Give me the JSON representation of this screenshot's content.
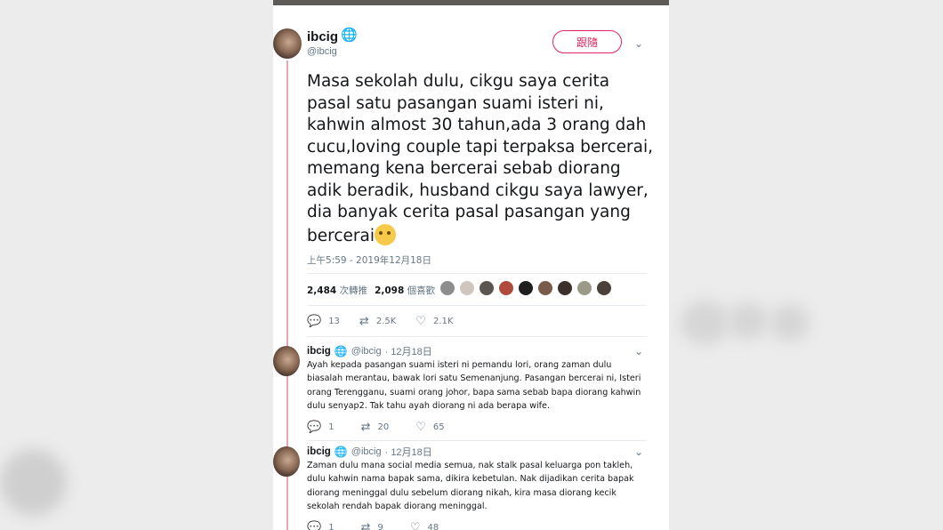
{
  "tweet": {
    "author_name": "ibcig",
    "author_handle": "@ibcig",
    "follow_label": "跟隨",
    "text": "Masa sekolah dulu, cikgu saya cerita pasal satu pasangan suami isteri ni, kahwin almost 30 tahun,ada 3 orang dah cucu,loving couple tapi terpaksa bercerai, memang kena bercerai sebab diorang adik beradik, husband cikgu saya lawyer, dia banyak cerita pasal pasangan yang bercerai",
    "timestamp": "上午5:59 - 2019年12月18日",
    "retweets_count": "2,484",
    "retweets_label": "次轉推",
    "likes_count": "2,098",
    "likes_label": "個喜歡",
    "liker_colors": [
      "#8d8d8d",
      "#cfc6c0",
      "#5b5552",
      "#b04a3c",
      "#1f1f1f",
      "#7a5a4a",
      "#3a2f2b",
      "#9a9a86",
      "#4b403a"
    ],
    "replies": "13",
    "retweets_short": "2.5K",
    "likes_short": "2.1K"
  },
  "replies": [
    {
      "name": "ibcig",
      "handle": "@ibcig",
      "date": "· 12月18日",
      "text": "Ayah kepada pasangan suami isteri ni pemandu lori, orang zaman dulu biasalah merantau, bawak lori satu Semenanjung. Pasangan bercerai ni, Isteri orang Terengganu, suami orang johor, bapa sama sebab bapa diorang kahwin dulu senyap2. Tak tahu ayah diorang ni ada berapa wife.",
      "reply_count": "1",
      "retweet_count": "20",
      "like_count": "65"
    },
    {
      "name": "ibcig",
      "handle": "@ibcig",
      "date": "· 12月18日",
      "text": "Zaman dulu mana social media semua, nak stalk pasal keluarga pon takleh, dulu kahwin nama bapak sama, dikira kebetulan. Nak dijadikan cerita bapak diorang meninggal dulu sebelum diorang nikah, kira masa diorang kecik sekolah rendah bapak diorang meninggal.",
      "reply_count": "1",
      "retweet_count": "9",
      "like_count": "48"
    }
  ],
  "icons": {
    "globe": "globe-icon",
    "reply": "reply-icon",
    "retweet": "retweet-icon",
    "like": "heart-icon",
    "chevron": "chevron-down-icon"
  },
  "colors": {
    "follow_accent": "#e0245e",
    "thread_line": "#e1a9b3",
    "link_blue": "#1da1f2"
  }
}
